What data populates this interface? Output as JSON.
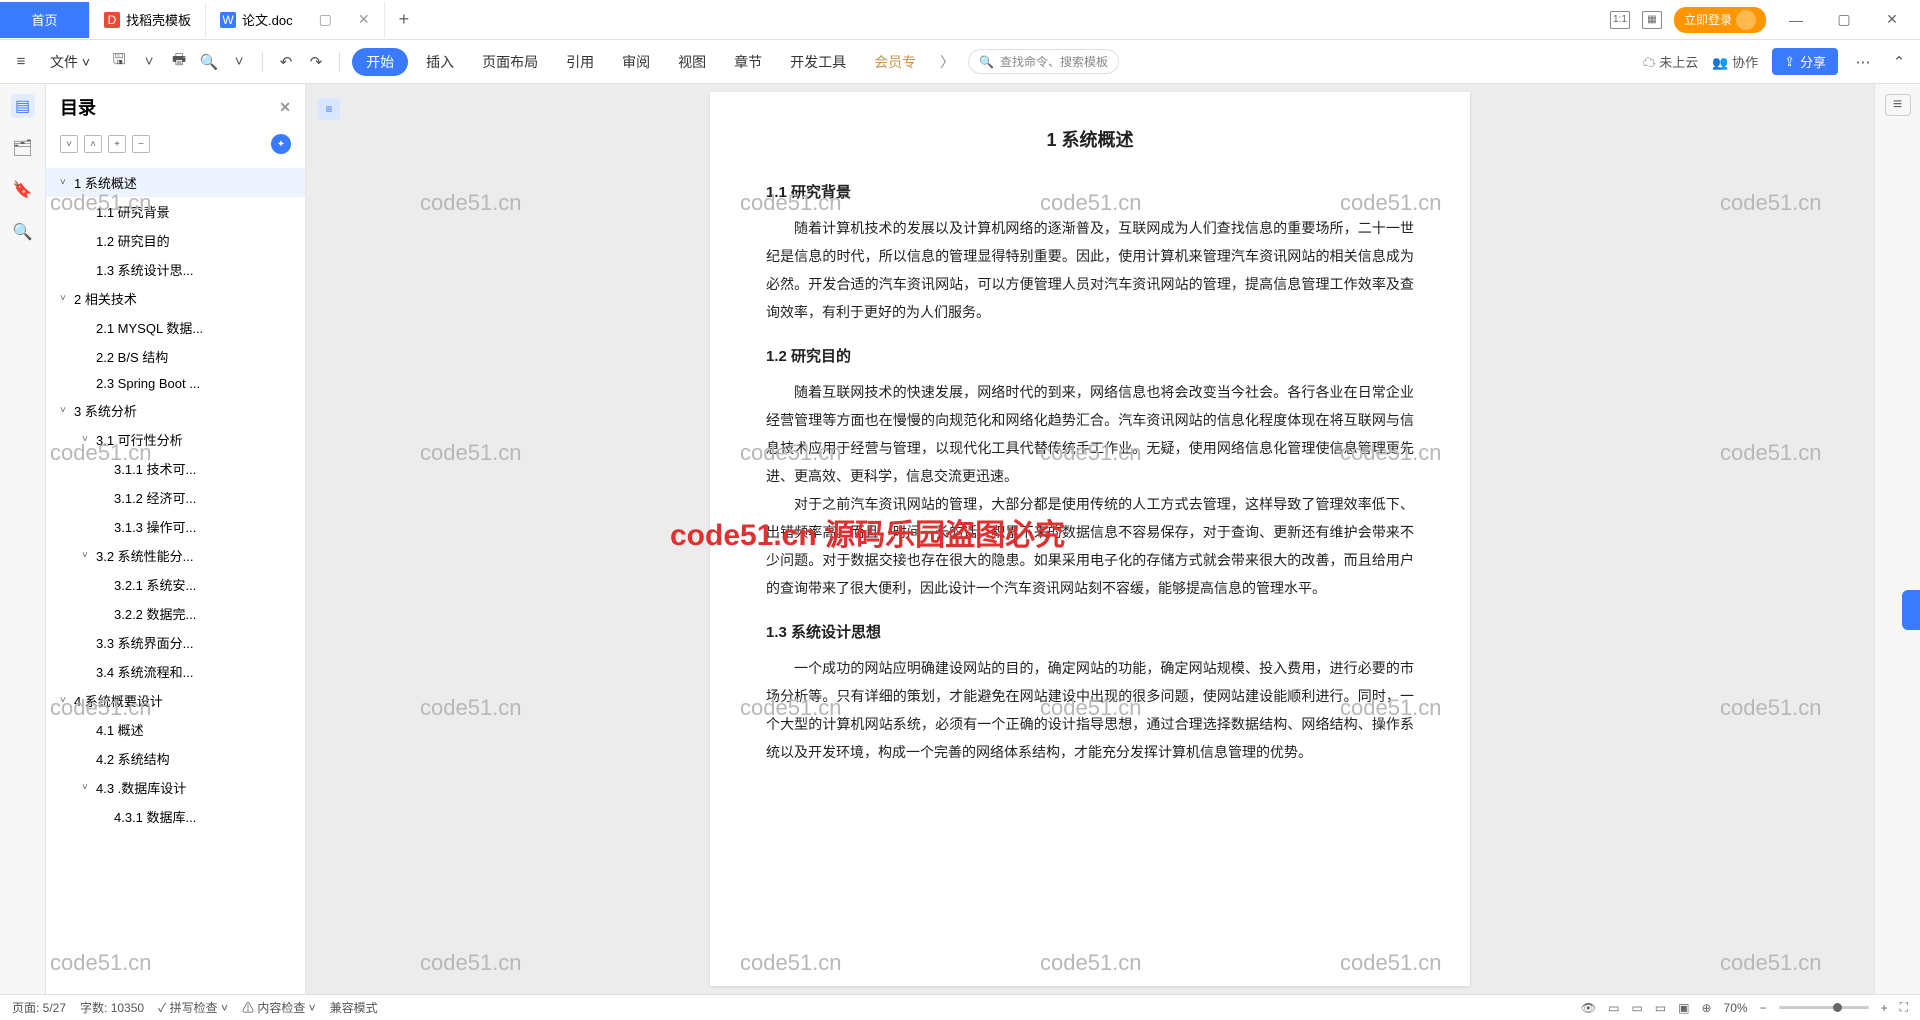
{
  "tabs": {
    "home": "首页",
    "t1": "找稻壳模板",
    "t2": "论文.doc"
  },
  "titlebar": {
    "login": "立即登录"
  },
  "ribbon": {
    "file": "文件",
    "start": "开始",
    "insert": "插入",
    "layout": "页面布局",
    "ref": "引用",
    "review": "审阅",
    "view": "视图",
    "chapter": "章节",
    "devtools": "开发工具",
    "vip": "会员专",
    "search": "查找命令、搜索模板",
    "cloud": "未上云",
    "collab": "协作",
    "share": "分享"
  },
  "outline": {
    "title": "目录",
    "items": [
      {
        "t": "1 系统概述",
        "lv": 1,
        "c": 1,
        "sel": 1
      },
      {
        "t": "1.1 研究背景",
        "lv": 2
      },
      {
        "t": "1.2 研究目的",
        "lv": 2
      },
      {
        "t": "1.3 系统设计思...",
        "lv": 2
      },
      {
        "t": "2 相关技术",
        "lv": 1,
        "c": 1
      },
      {
        "t": "2.1 MYSQL 数据...",
        "lv": 2
      },
      {
        "t": "2.2 B/S 结构",
        "lv": 2
      },
      {
        "t": "2.3 Spring Boot ...",
        "lv": 2
      },
      {
        "t": "3 系统分析",
        "lv": 1,
        "c": 1
      },
      {
        "t": "3.1 可行性分析",
        "lv": 2,
        "c": 1
      },
      {
        "t": "3.1.1 技术可...",
        "lv": 3
      },
      {
        "t": "3.1.2 经济可...",
        "lv": 3
      },
      {
        "t": "3.1.3 操作可...",
        "lv": 3
      },
      {
        "t": "3.2 系统性能分...",
        "lv": 2,
        "c": 1
      },
      {
        "t": "3.2.1 系统安...",
        "lv": 3
      },
      {
        "t": "3.2.2 数据完...",
        "lv": 3
      },
      {
        "t": "3.3 系统界面分...",
        "lv": 2
      },
      {
        "t": "3.4 系统流程和...",
        "lv": 2
      },
      {
        "t": "4 系统概要设计",
        "lv": 1,
        "c": 1
      },
      {
        "t": "4.1 概述",
        "lv": 2
      },
      {
        "t": "4.2 系统结构",
        "lv": 2
      },
      {
        "t": "4.3 .数据库设计",
        "lv": 2,
        "c": 1
      },
      {
        "t": "4.3.1 数据库...",
        "lv": 3
      }
    ]
  },
  "doc": {
    "h1": "1 系统概述",
    "s11": "1.1 研究背景",
    "p11": "随着计算机技术的发展以及计算机网络的逐渐普及，互联网成为人们查找信息的重要场所，二十一世纪是信息的时代，所以信息的管理显得特别重要。因此，使用计算机来管理汽车资讯网站的相关信息成为必然。开发合适的汽车资讯网站，可以方便管理人员对汽车资讯网站的管理，提高信息管理工作效率及查询效率，有利于更好的为人们服务。",
    "s12": "1.2 研究目的",
    "p12a": "随着互联网技术的快速发展，网络时代的到来，网络信息也将会改变当今社会。各行各业在日常企业经营管理等方面也在慢慢的向规范化和网络化趋势汇合。汽车资讯网站的信息化程度体现在将互联网与信息技术应用于经营与管理，以现代化工具代替传统手工作业。无疑，使用网络信息化管理使信息管理更先进、更高效、更科学，信息交流更迅速。",
    "p12b": "对于之前汽车资讯网站的管理，大部分都是使用传统的人工方式去管理，这样导致了管理效率低下、出错频率高。而且，时间一长的话，积累下来的数据信息不容易保存，对于查询、更新还有维护会带来不少问题。对于数据交接也存在很大的隐患。如果采用电子化的存储方式就会带来很大的改善，而且给用户的查询带来了很大便利，因此设计一个汽车资讯网站刻不容缓，能够提高信息的管理水平。",
    "s13": "1.3 系统设计思想",
    "p13": "一个成功的网站应明确建设网站的目的，确定网站的功能，确定网站规模、投入费用，进行必要的市场分析等。只有详细的策划，才能避免在网站建设中出现的很多问题，使网站建设能顺利进行。同时，一个大型的计算机网站系统，必须有一个正确的设计指导思想，通过合理选择数据结构、网络结构、操作系统以及开发环境，构成一个完善的网络体系结构，才能充分发挥计算机信息管理的优势。"
  },
  "status": {
    "page": "页面: 5/27",
    "words": "字数: 10350",
    "spell": "拼写检查",
    "content": "内容检查",
    "compat": "兼容模式",
    "zoom": "70%"
  },
  "watermark": "code51.cn",
  "watermark_red": "code51.cn  源码乐园盗图必究"
}
